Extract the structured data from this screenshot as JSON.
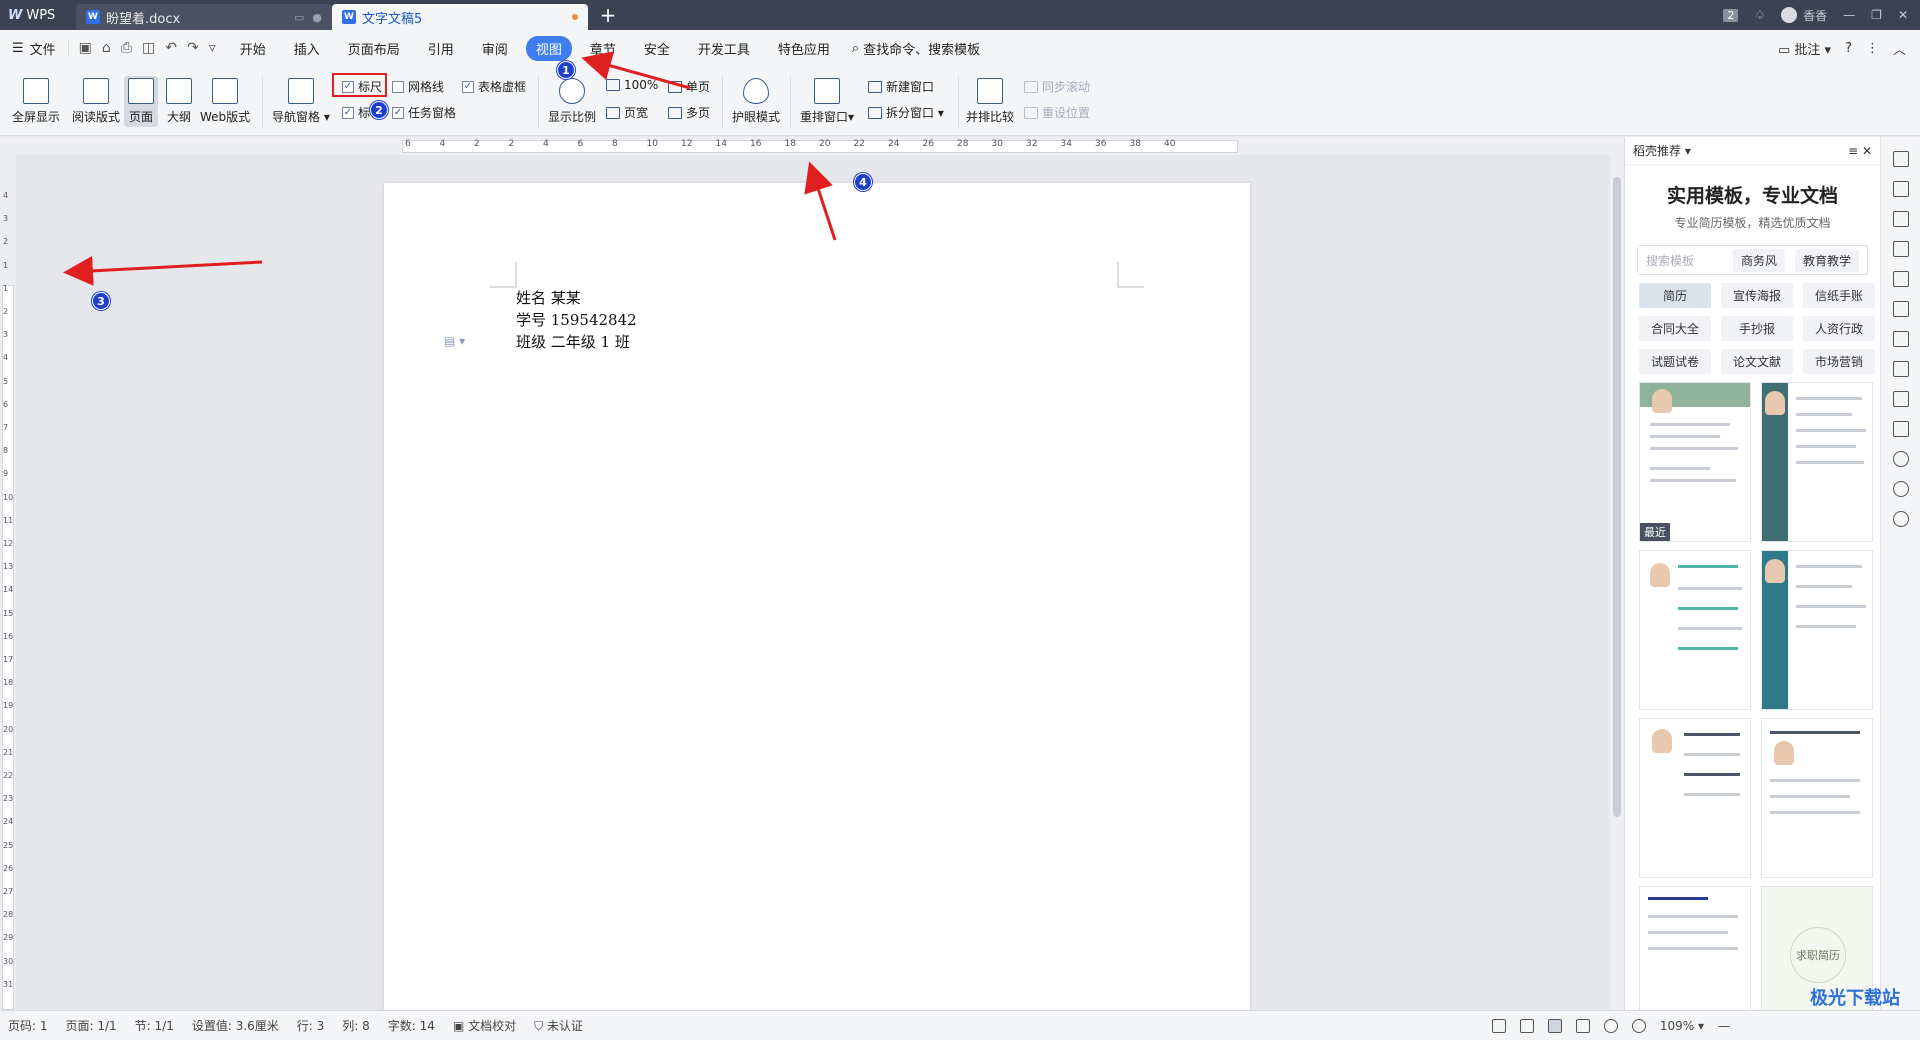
{
  "titlebar": {
    "app_name": "WPS",
    "tabs": [
      {
        "label": "盼望着.docx"
      },
      {
        "label": "文字文稿5"
      }
    ],
    "badge": "2",
    "user": "香香"
  },
  "menubar": {
    "file_label": "文件",
    "items": [
      "开始",
      "插入",
      "页面布局",
      "引用",
      "审阅",
      "视图",
      "章节",
      "安全",
      "开发工具",
      "特色应用"
    ],
    "active": "视图",
    "search_label": "查找命令、搜索模板",
    "comment_label": "批注"
  },
  "ribbon": {
    "fullscreen": "全屏显示",
    "read_mode": "阅读版式",
    "page": "页面",
    "outline": "大纲",
    "web": "Web版式",
    "nav_pane": "导航窗格",
    "ruler": "标尺",
    "gridlines": "网格线",
    "table_gridlines": "表格虚框",
    "mark": "标",
    "task_pane": "任务窗格",
    "zoom": "显示比例",
    "zoom_100": "100%",
    "single_page": "单页",
    "page_width": "页宽",
    "multi_page": "多页",
    "eye_mode": "护眼模式",
    "arrange": "重排窗口",
    "new_window": "新建窗口",
    "split_window": "拆分窗口",
    "side_by_side": "并排比较",
    "sync_scroll": "同步滚动",
    "reset_position": "重设位置"
  },
  "annotations": [
    "1",
    "2",
    "3",
    "4"
  ],
  "ruler": {
    "h_ticks": [
      "6",
      "4",
      "2",
      "2",
      "4",
      "6",
      "8",
      "10",
      "12",
      "14",
      "16",
      "18",
      "20",
      "22",
      "24",
      "26",
      "28",
      "30",
      "32",
      "34",
      "36",
      "38",
      "40"
    ],
    "v_ticks": [
      "4",
      "3",
      "2",
      "1",
      "1",
      "2",
      "3",
      "4",
      "5",
      "6",
      "7",
      "8",
      "9",
      "10",
      "11",
      "12",
      "13",
      "14",
      "15",
      "16",
      "17",
      "18",
      "19",
      "20",
      "21",
      "22",
      "23",
      "24",
      "25",
      "26",
      "27",
      "28",
      "29",
      "30",
      "31"
    ]
  },
  "document": {
    "lines": [
      "姓名  某某",
      "学号  159542842",
      "班级  二年级 1 班"
    ]
  },
  "right_panel": {
    "header": "稻壳推荐",
    "title": "实用模板，专业文档",
    "subtitle": "专业简历模板，精选优质文档",
    "search_placeholder": "搜索模板",
    "chips": [
      "商务风",
      "教育教学"
    ],
    "categories": [
      "简历",
      "宣传海报",
      "信纸手账",
      "合同大全",
      "手抄报",
      "人资行政",
      "试题试卷",
      "论文文献",
      "市场营销"
    ],
    "recent_tag": "最近",
    "card_text": "求职简历"
  },
  "statusbar": {
    "page_no": "页码: 1",
    "pages": "页面: 1/1",
    "section": "节: 1/1",
    "setting": "设置值: 3.6厘米",
    "row": "行: 3",
    "col": "列: 8",
    "words": "字数: 14",
    "proof": "文档校对",
    "cert": "未认证",
    "zoom": "109%"
  },
  "watermark": "极光下载站",
  "colors": {
    "accent": "#3f7ef0",
    "titlebar": "#3b4252",
    "annotation_red": "#e02020",
    "marker_blue": "#1f3fcf"
  }
}
